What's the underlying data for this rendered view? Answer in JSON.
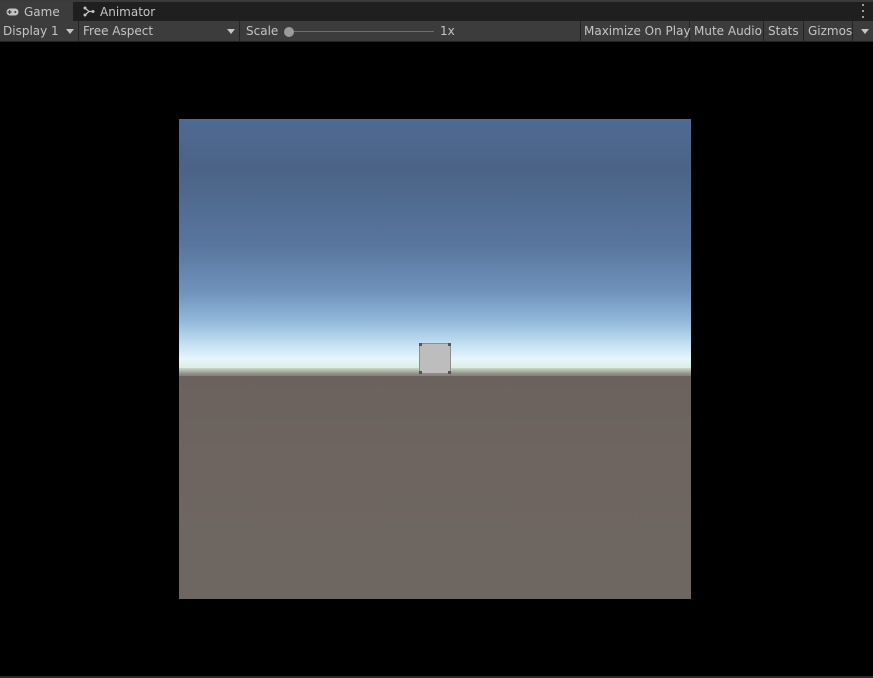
{
  "tabs": [
    {
      "label": "Game",
      "icon": "gamepad-icon",
      "active": true
    },
    {
      "label": "Animator",
      "icon": "animator-icon",
      "active": false
    }
  ],
  "toolbar": {
    "display": "Display 1",
    "aspect": "Free Aspect",
    "scale_label": "Scale",
    "scale_value": "1x",
    "scale_slider_fraction": 0.0,
    "maximize_on_play": "Maximize On Play",
    "mute_audio": "Mute Audio",
    "stats": "Stats",
    "gizmos": "Gizmos"
  },
  "colors": {
    "window_bg": "#000000",
    "toolbar_bg": "#3c3c3c",
    "sky_top": "#4f6a93",
    "horizon": "#e6f6fb",
    "ground": "#6e6560",
    "cube": "#bdbdbd"
  }
}
